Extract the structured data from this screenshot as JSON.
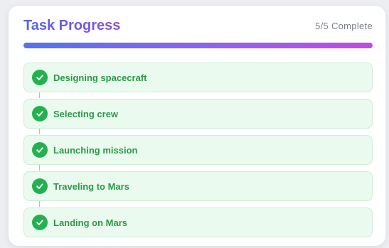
{
  "header": {
    "title": "Task Progress",
    "status": "5/5 Complete",
    "progress_fraction": 1.0
  },
  "colors": {
    "accent_start": "#5166e6",
    "accent_end": "#c24ae2",
    "success": "#23b150",
    "success_text": "#2a9a48",
    "item_bg": "#eafaee"
  },
  "tasks": [
    {
      "label": "Designing spacecraft",
      "status": "complete",
      "icon": "check-icon"
    },
    {
      "label": "Selecting crew",
      "status": "complete",
      "icon": "check-icon"
    },
    {
      "label": "Launching mission",
      "status": "complete",
      "icon": "check-icon"
    },
    {
      "label": "Traveling to Mars",
      "status": "complete",
      "icon": "check-icon"
    },
    {
      "label": "Landing on Mars",
      "status": "complete",
      "icon": "check-icon"
    }
  ]
}
